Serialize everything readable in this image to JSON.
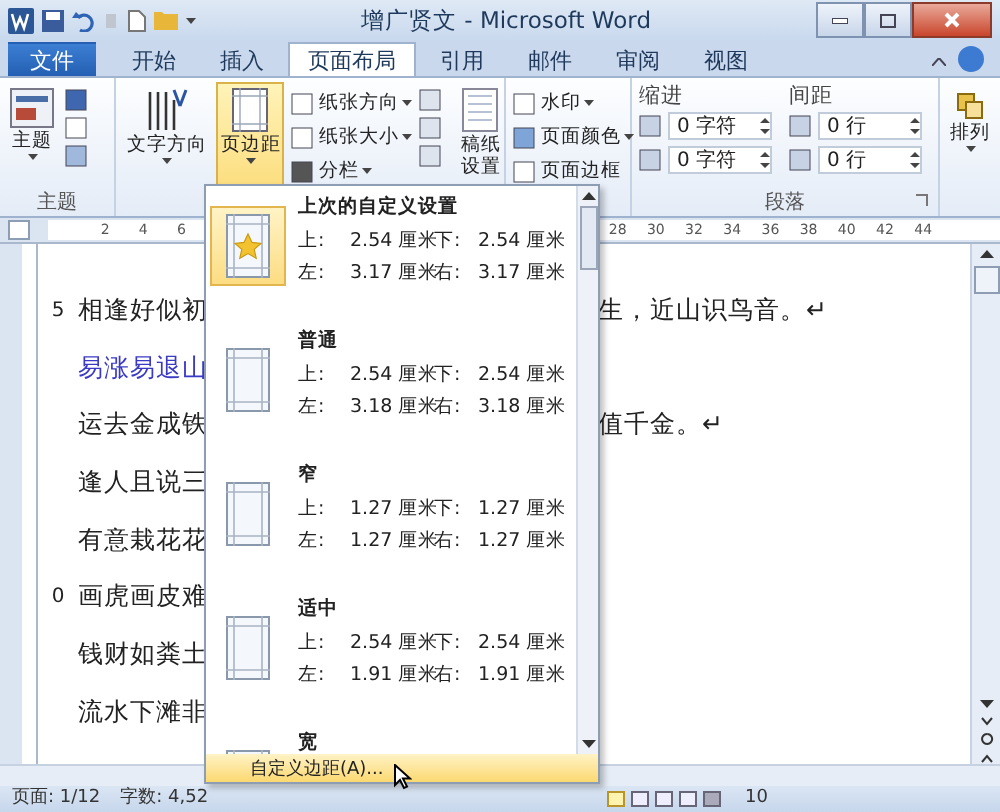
{
  "window": {
    "title": "增广贤文 - Microsoft Word"
  },
  "tabs": [
    {
      "label": "文件",
      "kind": "file",
      "selected": false
    },
    {
      "label": "开始",
      "kind": "tab",
      "selected": false
    },
    {
      "label": "插入",
      "kind": "tab",
      "selected": false
    },
    {
      "label": "页面布局",
      "kind": "tab",
      "selected": true
    },
    {
      "label": "引用",
      "kind": "tab",
      "selected": false
    },
    {
      "label": "邮件",
      "kind": "tab",
      "selected": false
    },
    {
      "label": "审阅",
      "kind": "tab",
      "selected": false
    },
    {
      "label": "视图",
      "kind": "tab",
      "selected": false
    }
  ],
  "ribbon": {
    "themes": {
      "button": "主题",
      "group_label": "主题"
    },
    "text_direction": "文字方向",
    "margins": {
      "label": "页边距",
      "expanded": true
    },
    "page_setup": [
      "纸张方向",
      "纸张大小",
      "分栏"
    ],
    "manuscript": [
      "稿纸",
      "设置"
    ],
    "background": [
      "水印",
      "页面颜色",
      "页面边框"
    ],
    "indent": {
      "label": "缩进",
      "fields": [
        "0 字符",
        "0 字符"
      ]
    },
    "spacing": {
      "label": "间距",
      "fields": [
        "0 行",
        "0 行"
      ]
    },
    "paragraph_label": "段落",
    "arrange": "排列"
  },
  "ruler": {
    "left_ticks": [
      "2",
      "4",
      "6"
    ],
    "right_ticks": [
      "28",
      "30",
      "32",
      "34",
      "36",
      "38",
      "40",
      "42",
      "44"
    ]
  },
  "document": {
    "lines": [
      {
        "number": "5",
        "text": "相逢好似初",
        "tail": "生，近山识鸟音。↵",
        "color": "#222222"
      },
      {
        "text": "易涨易退山",
        "color": "#3a3ac4"
      },
      {
        "text": "运去金成铁",
        "tail": "值千金。↵",
        "color": "#222222"
      },
      {
        "text": "逢人且说三",
        "color": "#222222"
      },
      {
        "text": "有意栽花花",
        "color": "#222222"
      },
      {
        "number": "0",
        "text": "画虎画皮难",
        "color": "#222222"
      },
      {
        "text": "钱财如粪土",
        "color": "#222222"
      },
      {
        "text": "流水下滩非",
        "color": "#222222"
      }
    ]
  },
  "margins_menu": {
    "items": [
      {
        "title": "上次的自定义设置",
        "kind": "custom",
        "selected": true,
        "rows": [
          {
            "a": "上:",
            "a_value": "2.54 厘米",
            "b": "下:",
            "b_value": "2.54 厘米"
          },
          {
            "a": "左:",
            "a_value": "3.17 厘米",
            "b": "右:",
            "b_value": "3.17 厘米"
          }
        ]
      },
      {
        "title": "普通",
        "kind": "page",
        "selected": false,
        "rows": [
          {
            "a": "上:",
            "a_value": "2.54 厘米",
            "b": "下:",
            "b_value": "2.54 厘米"
          },
          {
            "a": "左:",
            "a_value": "3.18 厘米",
            "b": "右:",
            "b_value": "3.18 厘米"
          }
        ]
      },
      {
        "title": "窄",
        "kind": "page",
        "selected": false,
        "rows": [
          {
            "a": "上:",
            "a_value": "1.27 厘米",
            "b": "下:",
            "b_value": "1.27 厘米"
          },
          {
            "a": "左:",
            "a_value": "1.27 厘米",
            "b": "右:",
            "b_value": "1.27 厘米"
          }
        ]
      },
      {
        "title": "适中",
        "kind": "page",
        "selected": false,
        "rows": [
          {
            "a": "上:",
            "a_value": "2.54 厘米",
            "b": "下:",
            "b_value": "2.54 厘米"
          },
          {
            "a": "左:",
            "a_value": "1.91 厘米",
            "b": "右:",
            "b_value": "1.91 厘米"
          }
        ]
      },
      {
        "title": "宽",
        "kind": "page",
        "selected": false
      }
    ],
    "footer": {
      "label": "自定义边距(A)...",
      "selected": true
    }
  },
  "status_bar": {
    "page": "页面: 1/12",
    "words": "字数: 4,52",
    "zoom": "10"
  }
}
